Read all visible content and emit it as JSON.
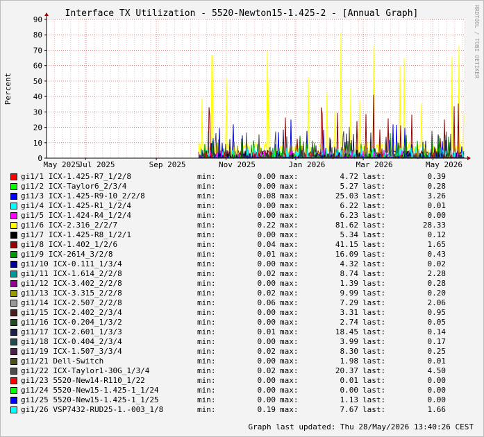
{
  "chart_data": {
    "type": "line",
    "title": "Interface TX Utilization - 5520-Newton15-1.425-2 - [Annual Graph]",
    "ylabel": "Percent",
    "watermark": "RRDTOOL / TOBI OETIKER",
    "ylim": [
      0,
      90
    ],
    "yticks": [
      0,
      10,
      20,
      30,
      40,
      50,
      60,
      70,
      80,
      90
    ],
    "xrange": [
      "2025-05-28",
      "2026-05-28"
    ],
    "xticks": [
      {
        "date": "2025-05-01",
        "label": "May 2025"
      },
      {
        "date": "2025-07-01",
        "label": "Jul 2025"
      },
      {
        "date": "2025-09-01",
        "label": "Sep 2025"
      },
      {
        "date": "2025-11-01",
        "label": "Nov 2025"
      },
      {
        "date": "2026-01-01",
        "label": "Jan 2026"
      },
      {
        "date": "2026-03-01",
        "label": "Mar 2026"
      },
      {
        "date": "2026-05-01",
        "label": "May 2026"
      }
    ],
    "data_start": "2025-10-08",
    "grid": true,
    "series": [
      {
        "name": "gi1/1 ICX-1.425-R7_1/2/8",
        "color": "#ff0000",
        "min": "0.00",
        "max": "4.72",
        "last": "0.39"
      },
      {
        "name": "gi1/2 ICX-Taylor6_2/3/4",
        "color": "#00ff00",
        "min": "0.00",
        "max": "5.27",
        "last": "0.28"
      },
      {
        "name": "gi1/3 ICX-1.425-R9-10_2/2/8",
        "color": "#0000ff",
        "min": "0.08",
        "max": "25.03",
        "last": "3.26"
      },
      {
        "name": "gi1/4 ICX-1.425-R1_1/2/4",
        "color": "#00ffff",
        "min": "0.00",
        "max": "6.22",
        "last": "0.01"
      },
      {
        "name": "gi1/5 ICX-1.424-R4_1/2/4",
        "color": "#ff00ff",
        "min": "0.00",
        "max": "6.23",
        "last": "0.00"
      },
      {
        "name": "gi1/6 ICX-2.316_2/2/7",
        "color": "#ffff00",
        "min": "0.22",
        "max": "81.62",
        "last": "28.33"
      },
      {
        "name": "gi1/7 ICX-1.425-R8_1/2/1",
        "color": "#000000",
        "min": "0.00",
        "max": "5.34",
        "last": "0.12"
      },
      {
        "name": "gi1/8 ICX-1.402_1/2/6",
        "color": "#990000",
        "min": "0.04",
        "max": "41.15",
        "last": "1.65"
      },
      {
        "name": "gi1/9 ICX-2614_3/2/8",
        "color": "#009900",
        "min": "0.01",
        "max": "16.09",
        "last": "0.43"
      },
      {
        "name": "gi1/10 ICX-0.111_1/3/4",
        "color": "#000099",
        "min": "0.00",
        "max": "4.32",
        "last": "0.02"
      },
      {
        "name": "gi1/11 ICX-1.614_2/2/8",
        "color": "#009999",
        "min": "0.02",
        "max": "8.74",
        "last": "2.28"
      },
      {
        "name": "gi1/12 ICX-3.402_2/2/8",
        "color": "#990099",
        "min": "0.00",
        "max": "1.39",
        "last": "0.28"
      },
      {
        "name": "gi1/13 ICX-3.315_2/2/8",
        "color": "#999900",
        "min": "0.02",
        "max": "9.99",
        "last": "0.20"
      },
      {
        "name": "gi1/14 ICX-2.507_2/2/8",
        "color": "#999999",
        "min": "0.06",
        "max": "7.29",
        "last": "2.06"
      },
      {
        "name": "gi1/15 ICX-2.402_2/3/4",
        "color": "#4d1f1f",
        "min": "0.00",
        "max": "3.31",
        "last": "0.95"
      },
      {
        "name": "gi1/16 ICX-0.204_1/3/2",
        "color": "#1f4d1f",
        "min": "0.00",
        "max": "2.74",
        "last": "0.05"
      },
      {
        "name": "gi1/17 ICX-2.601_1/3/3",
        "color": "#1f1f4d",
        "min": "0.01",
        "max": "18.45",
        "last": "0.14"
      },
      {
        "name": "gi1/18 ICX-0.404_2/3/4",
        "color": "#1f4d4d",
        "min": "0.00",
        "max": "3.99",
        "last": "0.17"
      },
      {
        "name": "gi1/19 ICX-1.507_3/3/4",
        "color": "#4d1f4d",
        "min": "0.02",
        "max": "8.30",
        "last": "0.25"
      },
      {
        "name": "gi1/21 Dell-Switch",
        "color": "#4d4d1f",
        "min": "0.00",
        "max": "1.98",
        "last": "0.01"
      },
      {
        "name": "gi1/22 ICX-Taylor1-30G_1/3/4",
        "color": "#4d4d4d",
        "min": "0.02",
        "max": "20.37",
        "last": "4.50"
      },
      {
        "name": "gi1/23 5520-New14-R110_1/22",
        "color": "#ff0000",
        "min": "0.00",
        "max": "0.01",
        "last": "0.00"
      },
      {
        "name": "gi1/24 5520-New15-1.425-1_1/24",
        "color": "#00ff00",
        "min": "0.00",
        "max": "0.00",
        "last": "0.00"
      },
      {
        "name": "gi1/25 5520-New15-1.425-1_1/25",
        "color": "#0000ff",
        "min": "0.00",
        "max": "1.13",
        "last": "0.00"
      },
      {
        "name": "gi1/26 VSP7432-RUD25-1.-003_1/8",
        "color": "#00ffff",
        "min": "0.19",
        "max": "7.67",
        "last": "1.66"
      }
    ]
  },
  "legend": {
    "min_label": "min:",
    "max_label": "max:",
    "last_label": "last:"
  },
  "footer": "Graph last updated: Thu 28/May/2026 13:40:26 CEST"
}
